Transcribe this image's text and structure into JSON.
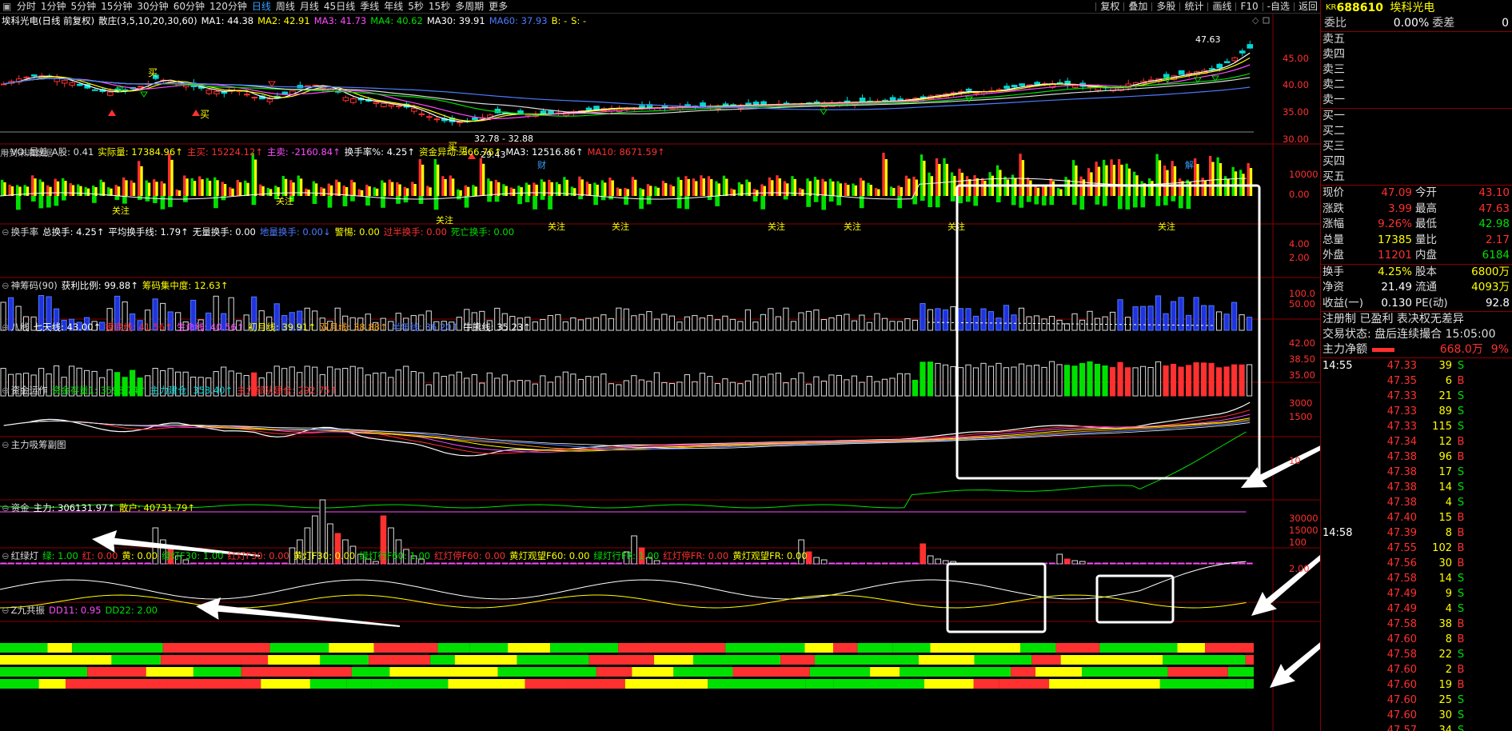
{
  "toolbar": {
    "periods": [
      "分时",
      "1分钟",
      "5分钟",
      "15分钟",
      "30分钟",
      "60分钟",
      "120分钟",
      "日线",
      "周线",
      "月线",
      "45日线",
      "季线",
      "年线",
      "5秒",
      "15秒",
      "多周期",
      "更多"
    ],
    "active": "日线",
    "tools": [
      "复权",
      "叠加",
      "多股",
      "统计",
      "画线",
      "F10",
      "-自选",
      "返回"
    ]
  },
  "main": {
    "stock": "埃科光电(日线 前复权)",
    "chip": "散庄(3,5,10,20,30,60)",
    "ma": [
      {
        "t": "MA1: 44.38",
        "c": "#ffffff"
      },
      {
        "t": "MA2: 42.91",
        "c": "#ffff00"
      },
      {
        "t": "MA3: 41.73",
        "c": "#ff4aff"
      },
      {
        "t": "MA4: 40.62",
        "c": "#00e000"
      },
      {
        "t": "MA30: 39.91",
        "c": "#ffffff"
      },
      {
        "t": "MA60: 37.93",
        "c": "#4d7bff"
      },
      {
        "t": "B: -",
        "c": "#ffff00"
      },
      {
        "t": "S: -",
        "c": "#ffff00"
      }
    ],
    "yticks": [
      "45.00",
      "40.00",
      "35.00",
      "30.00"
    ],
    "hi_label": "47.63",
    "lo_label1": "32.78 - 32.88",
    "lo_label2": "29.43",
    "future_note": "用到未来数据",
    "cai": "财",
    "jie": "解",
    "buy_signal": "买"
  },
  "panels": [
    {
      "key": "vol",
      "items": [
        {
          "t": "VOL量差",
          "c": "#dddddd"
        },
        {
          "t": "A股: 0.41",
          "c": "#dddddd"
        },
        {
          "t": "实际量: 17384.96↑",
          "c": "#ffff00"
        },
        {
          "t": "主买: 15224.12↑",
          "c": "#ff3030"
        },
        {
          "t": "主卖: -2160.84↑",
          "c": "#ff4aff"
        },
        {
          "t": "换手率%: 4.25↑",
          "c": "#ffffff"
        },
        {
          "t": "资金异动: 366.76↑",
          "c": "#ffff00"
        },
        {
          "t": "MA3: 12516.86↑",
          "c": "#ffffff"
        },
        {
          "t": "MA10: 8671.59↑",
          "c": "#ff3030"
        }
      ],
      "yticks": [
        "10000",
        "0.00"
      ],
      "tag": "关注",
      "tag2": "关注"
    },
    {
      "key": "turn",
      "items": [
        {
          "t": "换手率",
          "c": "#dddddd"
        },
        {
          "t": "总换手: 4.25↑",
          "c": "#ffffff"
        },
        {
          "t": "平均换手线: 1.79↑",
          "c": "#ffffff"
        },
        {
          "t": "无量换手: 0.00",
          "c": "#ffffff"
        },
        {
          "t": "地量换手: 0.00↓",
          "c": "#4d7bff"
        },
        {
          "t": "警惕: 0.00",
          "c": "#ffff00"
        },
        {
          "t": "过半换手: 0.00",
          "c": "#ff3030"
        },
        {
          "t": "死亡换手: 0.00",
          "c": "#00e000"
        }
      ],
      "yticks": [
        "4.00",
        "2.00"
      ]
    },
    {
      "key": "chip",
      "items": [
        {
          "t": "神筹码(90)",
          "c": "#dddddd"
        },
        {
          "t": "获利比例: 99.88↑",
          "c": "#ffffff"
        },
        {
          "t": "筹码集中度: 12.63↑",
          "c": "#ffff00"
        }
      ],
      "yticks": [
        "100.0",
        "50.00"
      ]
    },
    {
      "key": "eight",
      "items": [
        {
          "t": "八线",
          "c": "#dddddd"
        },
        {
          "t": "七天线: 43.00↑",
          "c": "#ffffff"
        },
        {
          "t": "摸底线: 41.56↑",
          "c": "#ff3030"
        },
        {
          "t": "生命线: 40.56↑",
          "c": "#ff4aff"
        },
        {
          "t": "初月线: 39.91↑",
          "c": "#ffff00"
        },
        {
          "t": "双月线: 38.88↑",
          "c": "#ff9900"
        },
        {
          "t": "半年线: 36.20↑",
          "c": "#4d7bff"
        },
        {
          "t": "牛熊线: 35.23↑",
          "c": "#ffffff"
        }
      ],
      "yticks": [
        "42.00",
        "38.50",
        "35.00"
      ]
    },
    {
      "key": "fund",
      "items": [
        {
          "t": "资金运作",
          "c": "#dddddd"
        },
        {
          "t": "资金存量1: 3598.74↑",
          "c": "#00e000"
        },
        {
          "t": "主力建仓: 358.40↑",
          "c": "#00d8d8"
        },
        {
          "t": "主力部队建仓: 292.75↑",
          "c": "#ff3030"
        }
      ],
      "yticks": [
        "3000",
        "1500"
      ]
    },
    {
      "key": "absorb",
      "items": [
        {
          "t": "主力吸筹副图",
          "c": "#dddddd"
        }
      ],
      "yticks": [
        "10"
      ]
    },
    {
      "key": "money",
      "items": [
        {
          "t": "资金",
          "c": "#dddddd"
        },
        {
          "t": "主力: 306131.97↑",
          "c": "#ffffff"
        },
        {
          "t": "散户: 40731.79↑",
          "c": "#ffff00"
        }
      ],
      "yticks": [
        "30000",
        "15000",
        "100"
      ]
    },
    {
      "key": "light",
      "items": [
        {
          "t": "红绿灯",
          "c": "#dddddd"
        },
        {
          "t": "绿: 1.00",
          "c": "#00e000"
        },
        {
          "t": "红: 0.00",
          "c": "#ff3030"
        },
        {
          "t": "黄: 0.00",
          "c": "#ffff00"
        },
        {
          "t": "绿灯F30: 1.00",
          "c": "#00e000"
        },
        {
          "t": "红灯F30: 0.00",
          "c": "#ff3030"
        },
        {
          "t": "黄灯F30: 0.00",
          "c": "#ffff00"
        },
        {
          "t": "绿灯行F60: 1.00",
          "c": "#00e000"
        },
        {
          "t": "红灯停F60: 0.00",
          "c": "#ff3030"
        },
        {
          "t": "黄灯观望F60: 0.00",
          "c": "#ffff00"
        },
        {
          "t": "绿灯行FR: 1.00",
          "c": "#00e000"
        },
        {
          "t": "红灯停FR: 0.00",
          "c": "#ff3030"
        },
        {
          "t": "黄灯观望FR: 0.00",
          "c": "#ffff00"
        }
      ],
      "yticks": [
        "2.00"
      ]
    },
    {
      "key": "nine",
      "items": [
        {
          "t": "Z九共振",
          "c": "#dddddd"
        },
        {
          "t": "DD11: 0.95",
          "c": "#ff4aff"
        },
        {
          "t": "DD22: 2.00",
          "c": "#00e000"
        }
      ],
      "yticks": []
    }
  ],
  "quote": {
    "kr": "KR",
    "code": "688610",
    "name": "埃科光电",
    "wbl": "委比",
    "wbv": "0.00%",
    "wc": "委差",
    "wcv": "0",
    "sell": [
      "卖五",
      "卖四",
      "卖三",
      "卖二",
      "卖一"
    ],
    "buy": [
      "买一",
      "买二",
      "买三",
      "买四",
      "买五"
    ],
    "stats": [
      [
        "现价",
        "47.09",
        "今开",
        "43.10",
        "red",
        "red"
      ],
      [
        "涨跌",
        "3.99",
        "最高",
        "47.63",
        "red",
        "red"
      ],
      [
        "涨幅",
        "9.26%",
        "最低",
        "42.98",
        "red",
        "green"
      ],
      [
        "总量",
        "17385",
        "量比",
        "2.17",
        "yellow",
        "red"
      ],
      [
        "外盘",
        "11201",
        "内盘",
        "6184",
        "red",
        "green"
      ]
    ],
    "stats2": [
      [
        "换手",
        "4.25%",
        "股本",
        "6800万",
        "yellow",
        "yellow"
      ],
      [
        "净资",
        "21.49",
        "流通",
        "4093万",
        "white",
        "yellow"
      ],
      [
        "收益(一)",
        "0.130",
        "PE(动)",
        "92.8",
        "white",
        "white"
      ]
    ],
    "reg": "注册制 已盈利 表决权无差异",
    "trade_state": "交易状态: 盘后连续撮合 15:05:00",
    "net_label": "主力净额",
    "net_value": "668.0万",
    "net_pct": "9%",
    "ticks": [
      [
        "14:55",
        "47.33",
        "39",
        "S"
      ],
      [
        "",
        "47.35",
        "6",
        "B"
      ],
      [
        "",
        "47.33",
        "21",
        "S"
      ],
      [
        "",
        "47.33",
        "89",
        "S"
      ],
      [
        "",
        "47.33",
        "115",
        "S"
      ],
      [
        "",
        "47.34",
        "12",
        "B"
      ],
      [
        "",
        "47.38",
        "96",
        "B"
      ],
      [
        "",
        "47.38",
        "17",
        "S"
      ],
      [
        "",
        "47.38",
        "14",
        "S"
      ],
      [
        "",
        "47.38",
        "4",
        "S"
      ],
      [
        "",
        "47.40",
        "15",
        "B"
      ],
      [
        "14:58",
        "47.39",
        "8",
        "B"
      ],
      [
        "",
        "47.55",
        "102",
        "B"
      ],
      [
        "",
        "47.56",
        "30",
        "B"
      ],
      [
        "",
        "47.58",
        "14",
        "S"
      ],
      [
        "",
        "47.49",
        "9",
        "S"
      ],
      [
        "",
        "47.49",
        "4",
        "S"
      ],
      [
        "",
        "47.58",
        "38",
        "B"
      ],
      [
        "",
        "47.60",
        "8",
        "B"
      ],
      [
        "",
        "47.58",
        "22",
        "S"
      ],
      [
        "",
        "47.60",
        "2",
        "B"
      ],
      [
        "",
        "47.60",
        "19",
        "B"
      ],
      [
        "",
        "47.60",
        "25",
        "S"
      ],
      [
        "",
        "47.60",
        "30",
        "S"
      ],
      [
        "",
        "47.57",
        "34",
        "S"
      ]
    ]
  }
}
